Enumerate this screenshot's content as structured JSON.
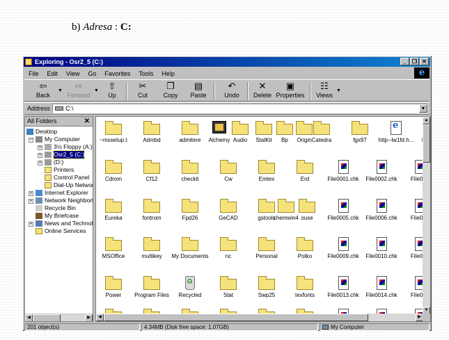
{
  "caption": {
    "prefix": "b) ",
    "term": "Adresa",
    "sep": " : ",
    "value": "C:"
  },
  "window": {
    "title": "Exploring - Osr2_5 (C:)",
    "controls": [
      "_",
      "❐",
      "✕"
    ]
  },
  "menu": [
    "File",
    "Edit",
    "View",
    "Go",
    "Favorites",
    "Tools",
    "Help"
  ],
  "toolbar": {
    "back": "Back",
    "forward": "Forward",
    "up": "Up",
    "cut": "Cut",
    "copy": "Copy",
    "paste": "Paste",
    "undo": "Undo",
    "delete": "Delete",
    "properties": "Properties",
    "views": "Views"
  },
  "address": {
    "label": "Address",
    "value": "C:\\"
  },
  "tree": {
    "header": "All Folders",
    "items": [
      {
        "label": "Desktop"
      },
      {
        "label": "My Computer"
      },
      {
        "label": "3½ Floppy (A:)"
      },
      {
        "label": "Osr2_5 (C:)"
      },
      {
        "label": "(D:)"
      },
      {
        "label": "Printers"
      },
      {
        "label": "Control Panel"
      },
      {
        "label": "Dial-Up Networ"
      },
      {
        "label": "Internet Explorer"
      },
      {
        "label": "Network Neighborh"
      },
      {
        "label": "Recycle Bin"
      },
      {
        "label": "My Briefcase"
      },
      {
        "label": "News and Technol"
      },
      {
        "label": "Online Services"
      }
    ]
  },
  "files": {
    "row1": [
      "~mssetup.t",
      "Admbd",
      "admitere",
      "Alchemy",
      "Audio",
      "StatKit",
      "Bp",
      "Origin",
      "Catedra",
      "fgx97",
      "http--lw1fd.h...",
      "http--lw"
    ],
    "row2": [
      "Cdrom",
      "Cf12",
      "checkit",
      "Cw",
      "Emtex",
      "Erd",
      "File0001.chk",
      "File0002.chk",
      "File000"
    ],
    "row3": [
      "Eureka",
      "fontrom",
      "Fpd26",
      "GeCAD",
      "gstools",
      "chemwin4",
      "ouse",
      "File0005.chk",
      "File0006.chk",
      "File000"
    ],
    "row4": [
      "MSOffice",
      "multikey",
      "My Documents",
      "nc",
      "Personal",
      "Potko",
      "File0009.chk",
      "File0010.chk",
      "File001"
    ],
    "row5": [
      "Power",
      "Program Files",
      "Recycled",
      "Stat",
      "Swp25",
      "texfonts",
      "File0013.chk",
      "File0014.chk",
      "File001"
    ]
  },
  "status": {
    "objects": "201 object(s)",
    "size": "4.34MB (Disk free space: 1.07GB)",
    "location": "My Computer"
  }
}
